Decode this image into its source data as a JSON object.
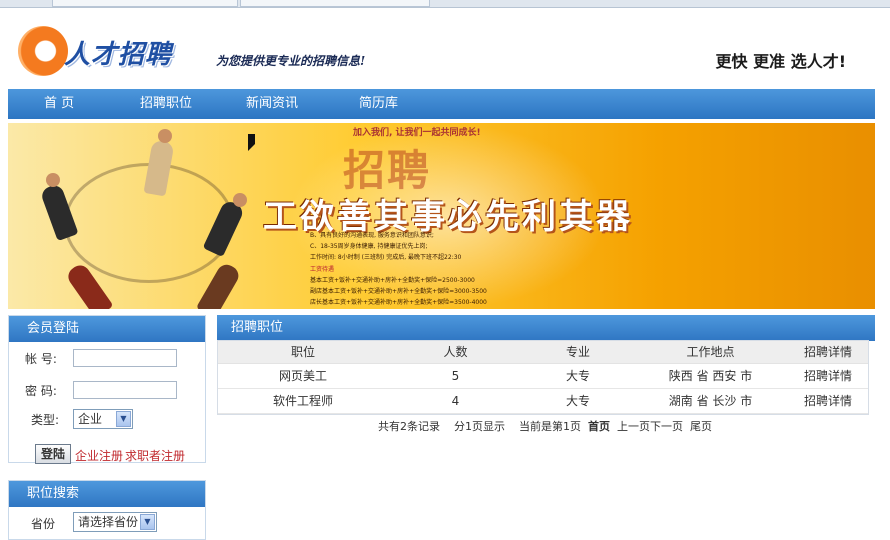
{
  "browser": {
    "tabs": [
      "",
      ""
    ]
  },
  "header": {
    "logo_text": "人才招聘",
    "slogan": "为您提供更专业的招聘信息!",
    "tagline": "更快 更准 选人才!"
  },
  "nav": {
    "items": [
      "首 页",
      "招聘职位",
      "新闻资讯",
      "简历库"
    ]
  },
  "banner": {
    "top_text": "加入我们, 让我们一起共同成长!",
    "big_text": "招聘",
    "title": "工欲善其事必先利其器",
    "lines": [
      "B、具有良好的沟通表现, 服务意识和团队意识;",
      "C、18-35周岁身体健康, 持健康证优先上岗;",
      "工作时间: 8小时制 (三班制) 完成后, 最晚下班不超22:30",
      "工资待遇",
      "基本工资+饭补+交通补助+房补+全勤奖+保险=2500-3000",
      "副店基本工资+饭补+交通补助+房补+全勤奖+保险=3000-3500",
      "店长基本工资+饭补+交通补助+房补+全勤奖+保险=3500-4000"
    ]
  },
  "login": {
    "title": "会员登陆",
    "account_label": "帐  号:",
    "password_label": "密  码:",
    "type_label": "类型:",
    "type_value": "企业",
    "login_button": "登陆",
    "company_register": "企业注册",
    "seeker_register": "求职者注册"
  },
  "search": {
    "title": "职位搜索",
    "province_label": "省份",
    "province_value": "请选择省份"
  },
  "jobs": {
    "title": "招聘职位",
    "columns": [
      "职位",
      "人数",
      "专业",
      "工作地点",
      "招聘详情"
    ],
    "rows": [
      {
        "position": "网页美工",
        "count": "5",
        "major": "大专",
        "location": "陕西 省 西安 市",
        "detail": "招聘详情"
      },
      {
        "position": "软件工程师",
        "count": "4",
        "major": "大专",
        "location": "湖南 省 长沙 市",
        "detail": "招聘详情"
      }
    ],
    "pager": {
      "total": "共有2条记录",
      "pages": "分1页显示",
      "current": "当前是第1页",
      "first": "首页",
      "prev": "上一页",
      "next": "下一页",
      "last": "尾页"
    }
  }
}
